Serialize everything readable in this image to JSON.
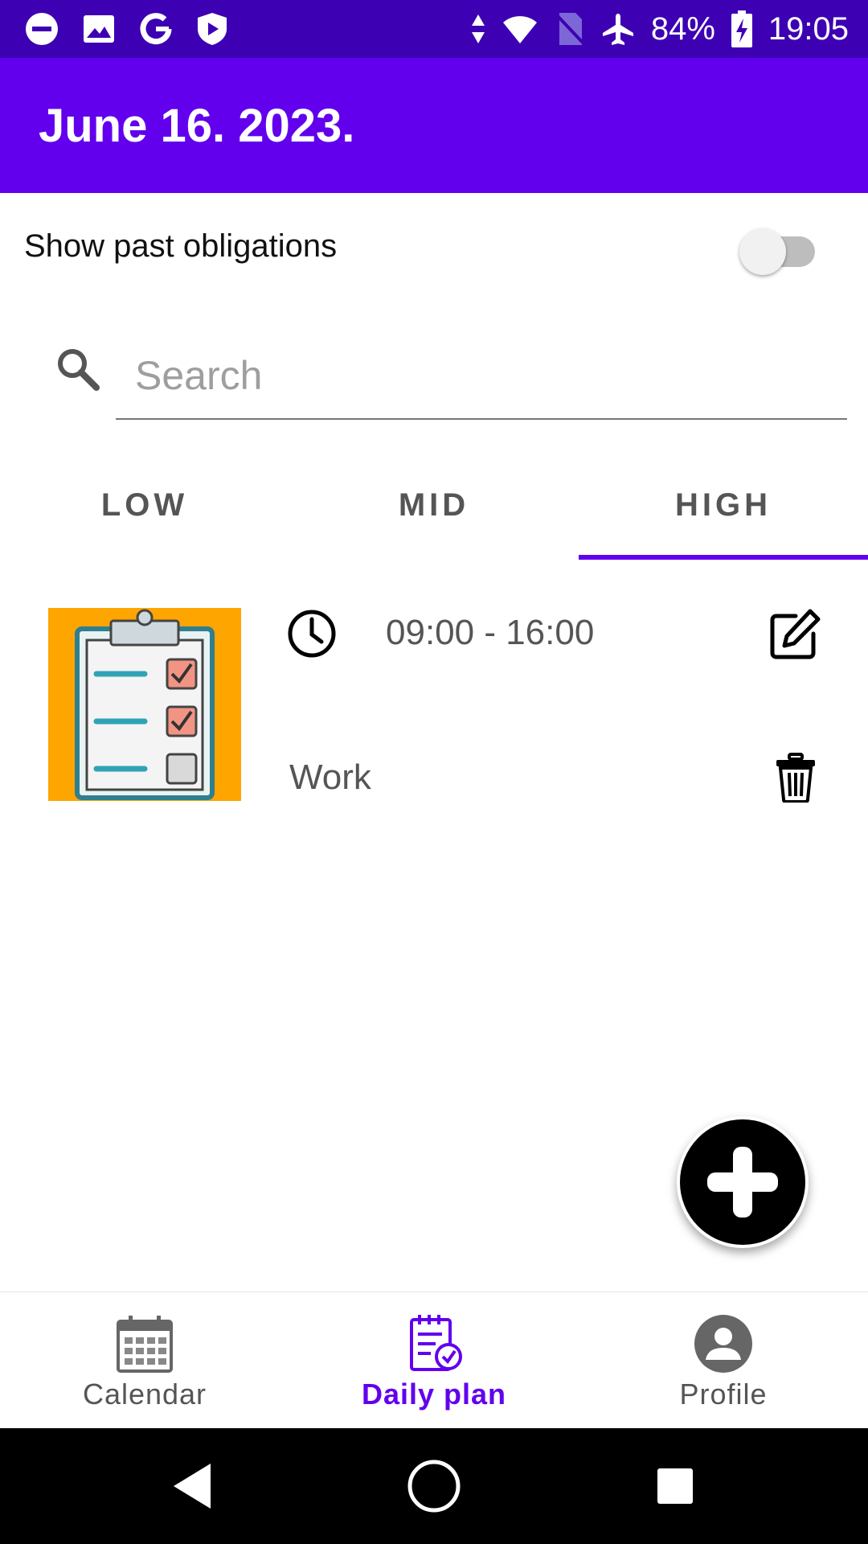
{
  "status_bar": {
    "battery": "84%",
    "time": "19:05"
  },
  "header": {
    "title": "June 16. 2023."
  },
  "filter": {
    "show_past_label": "Show past obligations",
    "show_past_enabled": false
  },
  "search": {
    "placeholder": "Search",
    "value": ""
  },
  "tabs": [
    {
      "label": "LOW",
      "selected": false
    },
    {
      "label": "MID",
      "selected": false
    },
    {
      "label": "HIGH",
      "selected": true
    }
  ],
  "items": [
    {
      "time": "09:00 - 16:00",
      "name": "Work",
      "thumbnail_icon": "clipboard-checklist-icon",
      "thumbnail_bg": "#ffa500"
    }
  ],
  "bottom_nav": [
    {
      "label": "Calendar",
      "icon": "calendar-icon",
      "active": false
    },
    {
      "label": "Daily plan",
      "icon": "daily-plan-icon",
      "active": true
    },
    {
      "label": "Profile",
      "icon": "profile-icon",
      "active": false
    }
  ],
  "colors": {
    "primary": "#6200ee",
    "status_bar": "#3d00b3",
    "accent_orange": "#ffa500"
  }
}
